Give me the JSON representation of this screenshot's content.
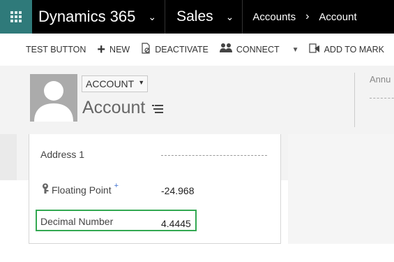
{
  "topbar": {
    "product": "Dynamics 365",
    "area": "Sales",
    "breadcrumbs": [
      "Accounts",
      "Account"
    ]
  },
  "commands": [
    {
      "label": "TEST BUTTON",
      "icon": ""
    },
    {
      "label": "NEW",
      "icon": "plus-icon"
    },
    {
      "label": "DEACTIVATE",
      "icon": "deactivate-icon"
    },
    {
      "label": "CONNECT",
      "icon": "connect-icon"
    },
    {
      "label": "ADD TO MARK",
      "icon": "marketing-list-icon"
    }
  ],
  "header": {
    "entity_type": "ACCOUNT",
    "record_name": "Account",
    "right_label": "Annu"
  },
  "form": {
    "fields": [
      {
        "label": "Address 1",
        "value": ""
      },
      {
        "label": "Floating Point",
        "value": "-24.968",
        "required_marker": "+"
      },
      {
        "label": "Decimal Number",
        "value": "4.4445"
      }
    ]
  },
  "colors": {
    "topbar_bg": "#000000",
    "waffle_bg": "#2f7a7a",
    "highlight": "#33a852"
  }
}
